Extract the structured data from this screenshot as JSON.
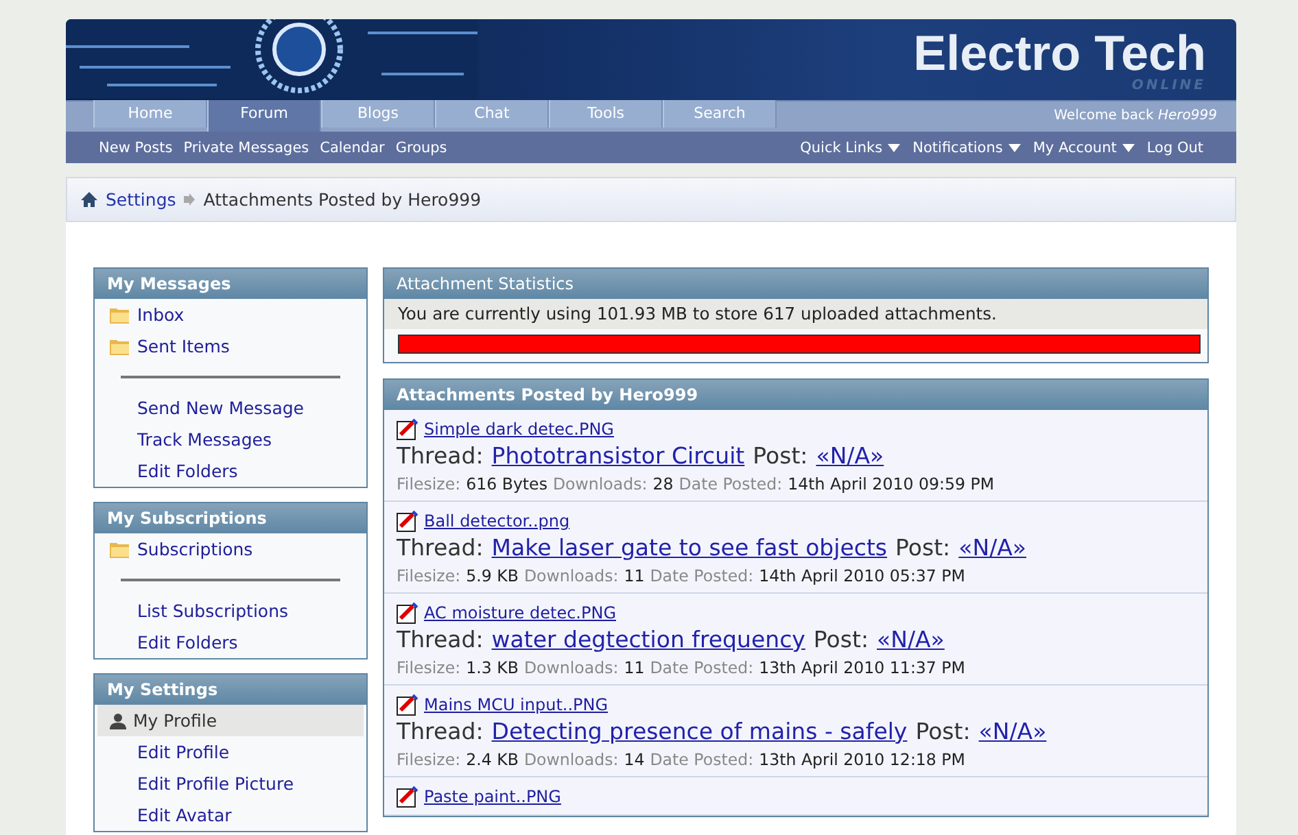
{
  "header": {
    "logo": "Electro Tech",
    "logo_sub": "ONLINE"
  },
  "tabs": [
    {
      "label": "Home",
      "selected": false
    },
    {
      "label": "Forum",
      "selected": true
    },
    {
      "label": "Blogs",
      "selected": false
    },
    {
      "label": "Chat",
      "selected": false
    },
    {
      "label": "Tools",
      "selected": false
    },
    {
      "label": "Search",
      "selected": false
    }
  ],
  "welcome": "Welcome back *Hero999*",
  "subnav_left": [
    "New Posts",
    "Private Messages",
    "Calendar",
    "Groups"
  ],
  "subnav_right": [
    {
      "label": "Quick Links",
      "dropdown": true
    },
    {
      "label": "Notifications",
      "dropdown": true
    },
    {
      "label": "My Account",
      "dropdown": true
    },
    {
      "label": "Log Out",
      "dropdown": false
    }
  ],
  "breadcrumb": {
    "link": "Settings",
    "current": "Attachments Posted by Hero999"
  },
  "sidebar": [
    {
      "title": "My Messages",
      "items": [
        {
          "kind": "folder",
          "label": "Inbox",
          "selected": false
        },
        {
          "kind": "folder",
          "label": "Sent Items",
          "selected": false
        },
        {
          "kind": "divider"
        },
        {
          "kind": "link",
          "label": "Send New Message",
          "selected": false
        },
        {
          "kind": "link",
          "label": "Track Messages",
          "selected": false
        },
        {
          "kind": "link",
          "label": "Edit Folders",
          "selected": false
        }
      ]
    },
    {
      "title": "My Subscriptions",
      "items": [
        {
          "kind": "folder",
          "label": "Subscriptions",
          "selected": false
        },
        {
          "kind": "divider"
        },
        {
          "kind": "link",
          "label": "List Subscriptions",
          "selected": false
        },
        {
          "kind": "link",
          "label": "Edit Folders",
          "selected": false
        }
      ]
    },
    {
      "title": "My Settings",
      "items": [
        {
          "kind": "profile",
          "label": "My Profile",
          "selected": true
        },
        {
          "kind": "link",
          "label": "Edit Profile",
          "selected": false
        },
        {
          "kind": "link",
          "label": "Edit Profile Picture",
          "selected": false
        },
        {
          "kind": "link",
          "label": "Edit Avatar",
          "selected": false
        }
      ]
    }
  ],
  "stats": {
    "title": "Attachment Statistics",
    "text": "You are currently using 101.93 MB to store 617 uploaded attachments.",
    "level": 1.0
  },
  "attachments": {
    "title": "Attachments Posted by Hero999",
    "items": [
      {
        "file": "Simple dark detec.PNG",
        "thread_label": "Thread:",
        "thread": "Phototransistor Circuit",
        "post_label": "Post:",
        "post": "«N/A»",
        "meta": [
          {
            "label": "Filesize:",
            "value": "616 Bytes"
          },
          {
            "label": "Downloads:",
            "value": "28"
          },
          {
            "label": "Date Posted:",
            "value": "14th April 2010 09:59 PM"
          }
        ]
      },
      {
        "file": "Ball detector..png",
        "thread_label": "Thread:",
        "thread": "Make laser gate to see fast objects",
        "post_label": "Post:",
        "post": "«N/A»",
        "meta": [
          {
            "label": "Filesize:",
            "value": "5.9 KB"
          },
          {
            "label": "Downloads:",
            "value": "11"
          },
          {
            "label": "Date Posted:",
            "value": "14th April 2010 05:37 PM"
          }
        ]
      },
      {
        "file": "AC moisture detec.PNG",
        "thread_label": "Thread:",
        "thread": "water degtection frequency",
        "post_label": "Post:",
        "post": "«N/A»",
        "meta": [
          {
            "label": "Filesize:",
            "value": "1.3 KB"
          },
          {
            "label": "Downloads:",
            "value": "11"
          },
          {
            "label": "Date Posted:",
            "value": "13th April 2010 11:37 PM"
          }
        ]
      },
      {
        "file": "Mains MCU input..PNG",
        "thread_label": "Thread:",
        "thread": "Detecting presence of mains - safely",
        "post_label": "Post:",
        "post": "«N/A»",
        "meta": [
          {
            "label": "Filesize:",
            "value": "2.4 KB"
          },
          {
            "label": "Downloads:",
            "value": "14"
          },
          {
            "label": "Date Posted:",
            "value": "13th April 2010 12:18 PM"
          }
        ]
      },
      {
        "file": "Paste paint..PNG"
      }
    ]
  }
}
